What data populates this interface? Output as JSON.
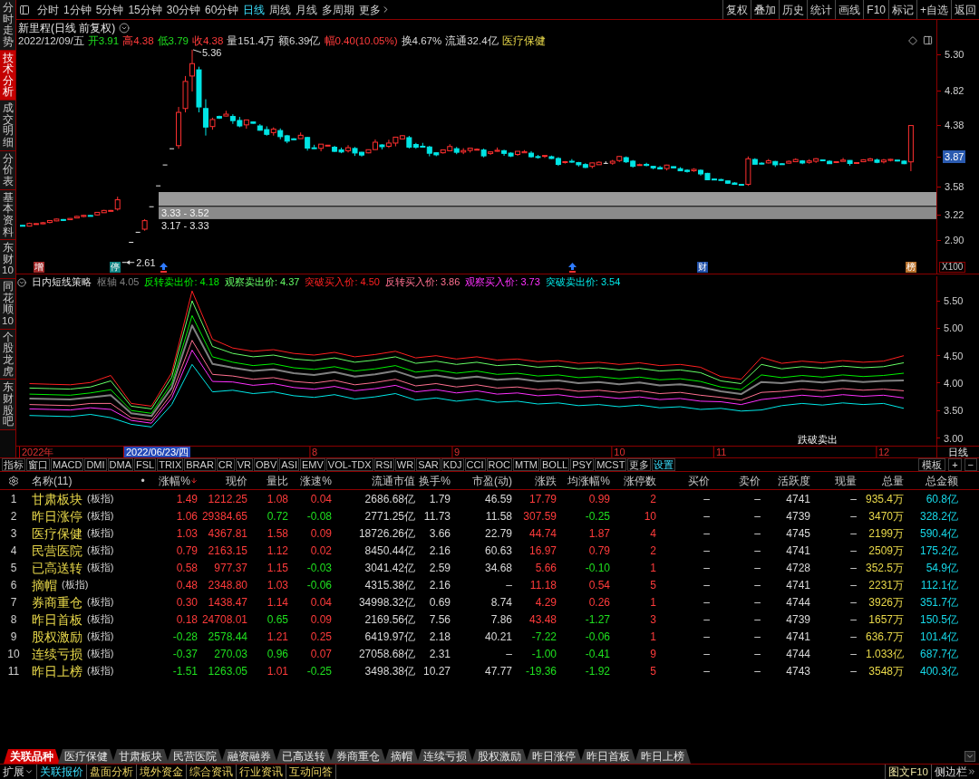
{
  "toolbar": {
    "periods": [
      {
        "label": "分时",
        "selected": false
      },
      {
        "label": "1分钟",
        "selected": false
      },
      {
        "label": "5分钟",
        "selected": false
      },
      {
        "label": "15分钟",
        "selected": false
      },
      {
        "label": "30分钟",
        "selected": false
      },
      {
        "label": "60分钟",
        "selected": false
      },
      {
        "label": "日线",
        "selected": true
      },
      {
        "label": "周线",
        "selected": false
      },
      {
        "label": "月线",
        "selected": false
      },
      {
        "label": "多周期",
        "selected": false
      }
    ],
    "more": "更多",
    "actions": [
      "复权",
      "叠加",
      "历史",
      "统计",
      "画线",
      "F10",
      "标记",
      "+自选",
      "返回"
    ]
  },
  "sidebar": {
    "tabs": [
      {
        "label": "分时走势",
        "selected": false
      },
      {
        "label": "技术分析",
        "selected": true
      },
      {
        "label": "成交明细",
        "selected": false
      },
      {
        "label": "分价表",
        "selected": false
      },
      {
        "label": "基本资料",
        "selected": false
      },
      {
        "label": "东财10",
        "selected": false
      },
      {
        "label": "同花顺10",
        "selected": false
      },
      {
        "label": "个股龙虎",
        "selected": false
      },
      {
        "label": "东财股吧",
        "selected": false
      }
    ]
  },
  "chart": {
    "title": "新里程(日线 前复权)",
    "date": "2022/12/09/五",
    "quote": [
      {
        "text": "开3.91",
        "color": "#1fe01f"
      },
      {
        "text": "高4.38",
        "color": "#ff3b3b"
      },
      {
        "text": "低3.79",
        "color": "#1fe01f"
      },
      {
        "text": "收4.38",
        "color": "#ff3b3b"
      },
      {
        "text": "量151.4万"
      },
      {
        "text": "额6.39亿"
      },
      {
        "text": "幅0.40(10.05%)",
        "color": "#ff3b3b"
      },
      {
        "text": "换4.67%"
      },
      {
        "text": "流通32.4亿"
      }
    ],
    "sector": "医疗保健",
    "high_label": "5.36",
    "low_label": "2.61",
    "gaps": [
      "3.33 - 3.52",
      "3.17 - 3.33"
    ],
    "markers": [
      {
        "kind": "text",
        "text": "增",
        "color": "#a02828"
      },
      {
        "kind": "text",
        "text": "停",
        "color": "#138585"
      },
      {
        "kind": "arrow"
      },
      {
        "kind": "arrow"
      },
      {
        "kind": "text",
        "text": "财",
        "color": "#1f4fa8"
      },
      {
        "kind": "text",
        "text": "榜",
        "color": "#b8702a"
      }
    ],
    "axis": [
      {
        "text": "5.30",
        "highlighted": false
      },
      {
        "text": "4.82",
        "highlighted": false
      },
      {
        "text": "4.38",
        "highlighted": false
      },
      {
        "text": "3.87",
        "highlighted": true
      },
      {
        "text": "3.58",
        "highlighted": false
      },
      {
        "text": "3.22",
        "highlighted": false
      },
      {
        "text": "2.90",
        "highlighted": false
      }
    ],
    "scale": "X100"
  },
  "indicator": {
    "name": "日内短线策略",
    "values": [
      "4.05",
      "4.18",
      "4.37",
      "4.50",
      "3.86",
      "3.73",
      "3.54"
    ],
    "signal": "跌破卖出",
    "chart_data": {
      "type": "line",
      "categories": [
        null,
        null,
        null,
        null,
        null,
        null,
        null,
        null,
        null,
        null,
        null,
        null,
        null,
        null,
        "8",
        null,
        null,
        null,
        null,
        null,
        null,
        "9",
        null,
        null,
        null,
        null,
        null,
        null,
        null,
        "10",
        null,
        null,
        null,
        null,
        "11",
        null,
        null,
        null,
        null,
        null,
        null,
        null,
        "12",
        null
      ],
      "ylim": [
        2.86,
        5.98
      ],
      "yticks": [
        {
          "value": 5.5,
          "label": "5.50"
        },
        {
          "value": 5.0,
          "label": "5.00"
        },
        {
          "value": 4.5,
          "label": "4.50"
        },
        {
          "value": 4.0,
          "label": "4.00"
        },
        {
          "value": 3.5,
          "label": "3.50"
        },
        {
          "value": 3.0,
          "label": "3.00"
        }
      ],
      "series": [
        {
          "name": "枢轴",
          "color": "#808080",
          "values": [
            3.72,
            3.71,
            3.7,
            3.74,
            3.78,
            3.45,
            3.4,
            3.92,
            5.05,
            4.35,
            4.28,
            4.22,
            4.25,
            4.18,
            4.15,
            4.2,
            4.12,
            4.16,
            4.22,
            4.1,
            4.14,
            4.08,
            4.12,
            4.06,
            4.08,
            4.03,
            4.05,
            4.0,
            4.02,
            3.98,
            4.01,
            3.96,
            3.98,
            3.93,
            3.85,
            3.8,
            4.02,
            4.0,
            4.04,
            4.01,
            4.05,
            4.02,
            4.04,
            4.05
          ]
        },
        {
          "name": "反转卖出价:",
          "color": "#00f000",
          "values": [
            3.8,
            3.79,
            3.78,
            3.82,
            3.88,
            3.5,
            3.45,
            4.0,
            5.23,
            4.48,
            4.38,
            4.32,
            4.35,
            4.28,
            4.25,
            4.3,
            4.22,
            4.26,
            4.32,
            4.2,
            4.24,
            4.18,
            4.22,
            4.16,
            4.18,
            4.13,
            4.15,
            4.1,
            4.12,
            4.08,
            4.11,
            4.06,
            4.08,
            4.03,
            3.93,
            3.88,
            4.15,
            4.1,
            4.14,
            4.11,
            4.15,
            4.12,
            4.14,
            4.18
          ]
        },
        {
          "name": "观察卖出价:",
          "color": "#66ff66",
          "values": [
            3.91,
            3.9,
            3.89,
            3.93,
            4.04,
            3.58,
            3.53,
            4.11,
            5.5,
            4.67,
            4.54,
            4.48,
            4.51,
            4.44,
            4.41,
            4.46,
            4.38,
            4.42,
            4.48,
            4.36,
            4.4,
            4.34,
            4.38,
            4.32,
            4.34,
            4.29,
            4.31,
            4.26,
            4.28,
            4.24,
            4.27,
            4.22,
            4.24,
            4.19,
            4.04,
            3.99,
            4.34,
            4.26,
            4.3,
            4.27,
            4.31,
            4.28,
            4.3,
            4.37
          ]
        },
        {
          "name": "突破买入价:",
          "color": "#ff2020",
          "values": [
            3.99,
            3.98,
            3.97,
            4.01,
            4.14,
            3.63,
            3.58,
            4.19,
            5.68,
            4.8,
            4.64,
            4.58,
            4.61,
            4.54,
            4.51,
            4.56,
            4.48,
            4.52,
            4.58,
            4.46,
            4.5,
            4.44,
            4.48,
            4.42,
            4.44,
            4.39,
            4.41,
            4.36,
            4.38,
            4.34,
            4.37,
            4.32,
            4.34,
            4.29,
            4.12,
            4.07,
            4.47,
            4.36,
            4.4,
            4.37,
            4.41,
            4.38,
            4.4,
            4.5
          ]
        },
        {
          "name": "反转买入价:",
          "color": "#ff7090",
          "values": [
            3.61,
            3.6,
            3.59,
            3.63,
            3.63,
            3.37,
            3.32,
            3.81,
            4.78,
            4.16,
            4.13,
            4.07,
            4.1,
            4.03,
            4.0,
            4.05,
            3.97,
            4.01,
            4.07,
            3.95,
            3.99,
            3.93,
            3.97,
            3.91,
            3.93,
            3.88,
            3.9,
            3.85,
            3.87,
            3.83,
            3.86,
            3.81,
            3.83,
            3.78,
            3.74,
            3.69,
            3.83,
            3.85,
            3.89,
            3.86,
            3.9,
            3.87,
            3.89,
            3.86
          ]
        },
        {
          "name": "观察买入价:",
          "color": "#ff30ff",
          "values": [
            3.53,
            3.52,
            3.51,
            3.55,
            3.52,
            3.32,
            3.27,
            3.73,
            4.6,
            4.03,
            4.02,
            3.96,
            3.99,
            3.92,
            3.89,
            3.94,
            3.86,
            3.9,
            3.96,
            3.84,
            3.88,
            3.82,
            3.86,
            3.8,
            3.82,
            3.77,
            3.79,
            3.74,
            3.76,
            3.72,
            3.75,
            3.7,
            3.72,
            3.67,
            3.66,
            3.61,
            3.7,
            3.74,
            3.78,
            3.75,
            3.79,
            3.76,
            3.78,
            3.73
          ]
        },
        {
          "name": "突破卖出价:",
          "color": "#00e8e8",
          "values": [
            3.41,
            3.4,
            3.39,
            3.43,
            3.37,
            3.25,
            3.2,
            3.61,
            4.34,
            3.84,
            3.87,
            3.81,
            3.84,
            3.77,
            3.74,
            3.79,
            3.71,
            3.75,
            3.81,
            3.69,
            3.73,
            3.67,
            3.71,
            3.65,
            3.67,
            3.62,
            3.64,
            3.59,
            3.61,
            3.57,
            3.6,
            3.55,
            3.57,
            3.52,
            3.54,
            3.49,
            3.51,
            3.59,
            3.63,
            3.6,
            3.64,
            3.61,
            3.63,
            3.54
          ]
        }
      ]
    }
  },
  "time_axis": {
    "year": "2022年",
    "cursor_date": "2022/06/23/四",
    "period": "日线"
  },
  "indicator_tabs": {
    "items": [
      {
        "label": "指标",
        "kind": "tab"
      },
      {
        "label": "窗口",
        "kind": "tab"
      },
      {
        "label": "MACD",
        "kind": "tab"
      },
      {
        "label": "DMI",
        "kind": "tab"
      },
      {
        "label": "DMA",
        "kind": "tab"
      },
      {
        "label": "FSL",
        "kind": "tab"
      },
      {
        "label": "TRIX",
        "kind": "tab"
      },
      {
        "label": "BRAR",
        "kind": "tab"
      },
      {
        "label": "CR",
        "kind": "tab"
      },
      {
        "label": "VR",
        "kind": "tab"
      },
      {
        "label": "OBV",
        "kind": "tab"
      },
      {
        "label": "ASI",
        "kind": "tab"
      },
      {
        "label": "EMV",
        "kind": "tab"
      },
      {
        "label": "VOL-TDX",
        "kind": "tab"
      },
      {
        "label": "RSI",
        "kind": "tab"
      },
      {
        "label": "WR",
        "kind": "tab"
      },
      {
        "label": "SAR",
        "kind": "tab"
      },
      {
        "label": "KDJ",
        "kind": "tab"
      },
      {
        "label": "CCI",
        "kind": "tab"
      },
      {
        "label": "ROC",
        "kind": "tab"
      },
      {
        "label": "MTM",
        "kind": "tab"
      },
      {
        "label": "BOLL",
        "kind": "tab"
      },
      {
        "label": "PSY",
        "kind": "tab"
      },
      {
        "label": "MCST",
        "kind": "tab"
      },
      {
        "label": "更多",
        "kind": "tab"
      },
      {
        "label": "设置",
        "kind": "setting"
      }
    ],
    "right": [
      "模板",
      "+",
      "−"
    ]
  },
  "table": {
    "name_header": "名称(11)",
    "dot_header": "•",
    "columns": [
      {
        "label": "涨幅%",
        "kind": "trend",
        "sorted": true
      },
      {
        "label": "现价",
        "kind": "trend",
        "sorted": false
      },
      {
        "label": "量比",
        "kind": "trend",
        "sorted": false
      },
      {
        "label": "涨速%",
        "kind": "trend",
        "sorted": false
      },
      {
        "label": "流通市值",
        "kind": "plain",
        "sorted": false
      },
      {
        "label": "换手%",
        "kind": "plain",
        "sorted": false
      },
      {
        "label": "市盈(动)",
        "kind": "plain",
        "sorted": false
      },
      {
        "label": "涨跌",
        "kind": "trend",
        "sorted": false
      },
      {
        "label": "均涨幅%",
        "kind": "trend",
        "sorted": false
      },
      {
        "label": "涨停数",
        "kind": "count",
        "sorted": false
      },
      {
        "label": "买价",
        "kind": "plain",
        "sorted": false
      },
      {
        "label": "卖价",
        "kind": "plain",
        "sorted": false
      },
      {
        "label": "活跃度",
        "kind": "plain",
        "sorted": false
      },
      {
        "label": "现量",
        "kind": "plain",
        "sorted": false
      },
      {
        "label": "总量",
        "kind": "volume",
        "sorted": false
      },
      {
        "label": "总金额",
        "kind": "amount",
        "sorted": false
      }
    ],
    "rows": [
      {
        "index": "1",
        "name": "甘肃板块",
        "tag": "(板指)",
        "cells": [
          {
            "text": "1.49",
            "color": "#ff3b3b"
          },
          {
            "text": "1212.25",
            "color": "#ff3b3b"
          },
          {
            "text": "1.08",
            "color": "#ff3b3b"
          },
          {
            "text": "0.04",
            "color": "#ff3b3b"
          },
          {
            "text": "2686.68亿"
          },
          {
            "text": "1.79"
          },
          {
            "text": "46.59"
          },
          {
            "text": "17.79",
            "color": "#ff3b3b"
          },
          {
            "text": "0.99",
            "color": "#ff3b3b"
          },
          {
            "text": "2"
          },
          {
            "text": "–"
          },
          {
            "text": "–"
          },
          {
            "text": "4741"
          },
          {
            "text": "–"
          },
          {
            "text": "935.4万"
          },
          {
            "text": "60.8亿"
          }
        ]
      },
      {
        "index": "2",
        "name": "昨日涨停",
        "tag": "(板指)",
        "cells": [
          {
            "text": "1.06",
            "color": "#ff3b3b"
          },
          {
            "text": "29384.65",
            "color": "#ff3b3b"
          },
          {
            "text": "0.72",
            "color": "#1fe01f"
          },
          {
            "text": "-0.08",
            "color": "#1fe01f"
          },
          {
            "text": "2771.25亿"
          },
          {
            "text": "11.73"
          },
          {
            "text": "11.58"
          },
          {
            "text": "307.59",
            "color": "#ff3b3b"
          },
          {
            "text": "-0.25",
            "color": "#1fe01f"
          },
          {
            "text": "10"
          },
          {
            "text": "–"
          },
          {
            "text": "–"
          },
          {
            "text": "4739"
          },
          {
            "text": "–"
          },
          {
            "text": "3470万"
          },
          {
            "text": "328.2亿"
          }
        ]
      },
      {
        "index": "3",
        "name": "医疗保健",
        "tag": "(板指)",
        "cells": [
          {
            "text": "1.03",
            "color": "#ff3b3b"
          },
          {
            "text": "4367.81",
            "color": "#ff3b3b"
          },
          {
            "text": "1.58",
            "color": "#ff3b3b"
          },
          {
            "text": "0.09",
            "color": "#ff3b3b"
          },
          {
            "text": "18726.26亿"
          },
          {
            "text": "3.66"
          },
          {
            "text": "22.79"
          },
          {
            "text": "44.74",
            "color": "#ff3b3b"
          },
          {
            "text": "1.87",
            "color": "#ff3b3b"
          },
          {
            "text": "4"
          },
          {
            "text": "–"
          },
          {
            "text": "–"
          },
          {
            "text": "4745"
          },
          {
            "text": "–"
          },
          {
            "text": "2199万"
          },
          {
            "text": "590.4亿"
          }
        ]
      },
      {
        "index": "4",
        "name": "民营医院",
        "tag": "(板指)",
        "cells": [
          {
            "text": "0.79",
            "color": "#ff3b3b"
          },
          {
            "text": "2163.15",
            "color": "#ff3b3b"
          },
          {
            "text": "1.12",
            "color": "#ff3b3b"
          },
          {
            "text": "0.02",
            "color": "#ff3b3b"
          },
          {
            "text": "8450.44亿"
          },
          {
            "text": "2.16"
          },
          {
            "text": "60.63"
          },
          {
            "text": "16.97",
            "color": "#ff3b3b"
          },
          {
            "text": "0.79",
            "color": "#ff3b3b"
          },
          {
            "text": "2"
          },
          {
            "text": "–"
          },
          {
            "text": "–"
          },
          {
            "text": "4741"
          },
          {
            "text": "–"
          },
          {
            "text": "2509万"
          },
          {
            "text": "175.2亿"
          }
        ]
      },
      {
        "index": "5",
        "name": "已高送转",
        "tag": "(板指)",
        "cells": [
          {
            "text": "0.58",
            "color": "#ff3b3b"
          },
          {
            "text": "977.37",
            "color": "#ff3b3b"
          },
          {
            "text": "1.15",
            "color": "#ff3b3b"
          },
          {
            "text": "-0.03",
            "color": "#1fe01f"
          },
          {
            "text": "3041.42亿"
          },
          {
            "text": "2.59"
          },
          {
            "text": "34.68"
          },
          {
            "text": "5.66",
            "color": "#ff3b3b"
          },
          {
            "text": "-0.10",
            "color": "#1fe01f"
          },
          {
            "text": "1"
          },
          {
            "text": "–"
          },
          {
            "text": "–"
          },
          {
            "text": "4728"
          },
          {
            "text": "–"
          },
          {
            "text": "352.5万"
          },
          {
            "text": "54.9亿"
          }
        ]
      },
      {
        "index": "6",
        "name": "摘帽",
        "tag": "(板指)",
        "cells": [
          {
            "text": "0.48",
            "color": "#ff3b3b"
          },
          {
            "text": "2348.80",
            "color": "#ff3b3b"
          },
          {
            "text": "1.03",
            "color": "#ff3b3b"
          },
          {
            "text": "-0.06",
            "color": "#1fe01f"
          },
          {
            "text": "4315.38亿"
          },
          {
            "text": "2.16"
          },
          {
            "text": "–"
          },
          {
            "text": "11.18",
            "color": "#ff3b3b"
          },
          {
            "text": "0.54",
            "color": "#ff3b3b"
          },
          {
            "text": "5"
          },
          {
            "text": "–"
          },
          {
            "text": "–"
          },
          {
            "text": "4741"
          },
          {
            "text": "–"
          },
          {
            "text": "2231万"
          },
          {
            "text": "112.1亿"
          }
        ]
      },
      {
        "index": "7",
        "name": "券商重仓",
        "tag": "(板指)",
        "cells": [
          {
            "text": "0.30",
            "color": "#ff3b3b"
          },
          {
            "text": "1438.47",
            "color": "#ff3b3b"
          },
          {
            "text": "1.14",
            "color": "#ff3b3b"
          },
          {
            "text": "0.04",
            "color": "#ff3b3b"
          },
          {
            "text": "34998.32亿"
          },
          {
            "text": "0.69"
          },
          {
            "text": "8.74"
          },
          {
            "text": "4.29",
            "color": "#ff3b3b"
          },
          {
            "text": "0.26",
            "color": "#ff3b3b"
          },
          {
            "text": "1"
          },
          {
            "text": "–"
          },
          {
            "text": "–"
          },
          {
            "text": "4744"
          },
          {
            "text": "–"
          },
          {
            "text": "3926万"
          },
          {
            "text": "351.7亿"
          }
        ]
      },
      {
        "index": "8",
        "name": "昨日首板",
        "tag": "(板指)",
        "cells": [
          {
            "text": "0.18",
            "color": "#ff3b3b"
          },
          {
            "text": "24708.01",
            "color": "#ff3b3b"
          },
          {
            "text": "0.65",
            "color": "#1fe01f"
          },
          {
            "text": "0.09",
            "color": "#ff3b3b"
          },
          {
            "text": "2169.56亿"
          },
          {
            "text": "7.56"
          },
          {
            "text": "7.86"
          },
          {
            "text": "43.48",
            "color": "#ff3b3b"
          },
          {
            "text": "-1.27",
            "color": "#1fe01f"
          },
          {
            "text": "3"
          },
          {
            "text": "–"
          },
          {
            "text": "–"
          },
          {
            "text": "4739"
          },
          {
            "text": "–"
          },
          {
            "text": "1657万"
          },
          {
            "text": "150.5亿"
          }
        ]
      },
      {
        "index": "9",
        "name": "股权激励",
        "tag": "(板指)",
        "cells": [
          {
            "text": "-0.28",
            "color": "#1fe01f"
          },
          {
            "text": "2578.44",
            "color": "#1fe01f"
          },
          {
            "text": "1.21",
            "color": "#ff3b3b"
          },
          {
            "text": "0.25",
            "color": "#ff3b3b"
          },
          {
            "text": "6419.97亿"
          },
          {
            "text": "2.18"
          },
          {
            "text": "40.21"
          },
          {
            "text": "-7.22",
            "color": "#1fe01f"
          },
          {
            "text": "-0.06",
            "color": "#1fe01f"
          },
          {
            "text": "1"
          },
          {
            "text": "–"
          },
          {
            "text": "–"
          },
          {
            "text": "4741"
          },
          {
            "text": "–"
          },
          {
            "text": "636.7万"
          },
          {
            "text": "101.4亿"
          }
        ]
      },
      {
        "index": "10",
        "name": "连续亏损",
        "tag": "(板指)",
        "cells": [
          {
            "text": "-0.37",
            "color": "#1fe01f"
          },
          {
            "text": "270.03",
            "color": "#1fe01f"
          },
          {
            "text": "0.96",
            "color": "#1fe01f"
          },
          {
            "text": "0.07",
            "color": "#ff3b3b"
          },
          {
            "text": "27058.68亿"
          },
          {
            "text": "2.31"
          },
          {
            "text": "–"
          },
          {
            "text": "-1.00",
            "color": "#1fe01f"
          },
          {
            "text": "-0.41",
            "color": "#1fe01f"
          },
          {
            "text": "9"
          },
          {
            "text": "–"
          },
          {
            "text": "–"
          },
          {
            "text": "4744"
          },
          {
            "text": "–"
          },
          {
            "text": "1.033亿"
          },
          {
            "text": "687.7亿"
          }
        ]
      },
      {
        "index": "11",
        "name": "昨日上榜",
        "tag": "(板指)",
        "cells": [
          {
            "text": "-1.51",
            "color": "#1fe01f"
          },
          {
            "text": "1263.05",
            "color": "#1fe01f"
          },
          {
            "text": "1.01",
            "color": "#ff3b3b"
          },
          {
            "text": "-0.25",
            "color": "#1fe01f"
          },
          {
            "text": "3498.38亿"
          },
          {
            "text": "10.27"
          },
          {
            "text": "47.77"
          },
          {
            "text": "-19.36",
            "color": "#1fe01f"
          },
          {
            "text": "-1.92",
            "color": "#1fe01f"
          },
          {
            "text": "5"
          },
          {
            "text": "–"
          },
          {
            "text": "–"
          },
          {
            "text": "4743"
          },
          {
            "text": "–"
          },
          {
            "text": "3548万"
          },
          {
            "text": "400.3亿"
          }
        ]
      }
    ]
  },
  "sector_tabs": [
    {
      "label": "关联品种",
      "selected": true
    },
    {
      "label": "医疗保健",
      "selected": false
    },
    {
      "label": "甘肃板块",
      "selected": false
    },
    {
      "label": "民营医院",
      "selected": false
    },
    {
      "label": "融资融券",
      "selected": false
    },
    {
      "label": "已高送转",
      "selected": false
    },
    {
      "label": "券商重仓",
      "selected": false
    },
    {
      "label": "摘帽",
      "selected": false
    },
    {
      "label": "连续亏损",
      "selected": false
    },
    {
      "label": "股权激励",
      "selected": false
    },
    {
      "label": "昨日涨停",
      "selected": false
    },
    {
      "label": "昨日首板",
      "selected": false
    },
    {
      "label": "昨日上榜",
      "selected": false
    }
  ],
  "bottom_bar": {
    "expand": "扩展",
    "links": [
      {
        "label": "关联报价",
        "selected": true
      },
      {
        "label": "盘面分析",
        "selected": false
      },
      {
        "label": "境外资金",
        "selected": false
      },
      {
        "label": "综合资讯",
        "selected": false
      },
      {
        "label": "行业资讯",
        "selected": false
      },
      {
        "label": "互动问答",
        "selected": false
      }
    ],
    "info": "图文F10",
    "side": "侧边栏"
  }
}
